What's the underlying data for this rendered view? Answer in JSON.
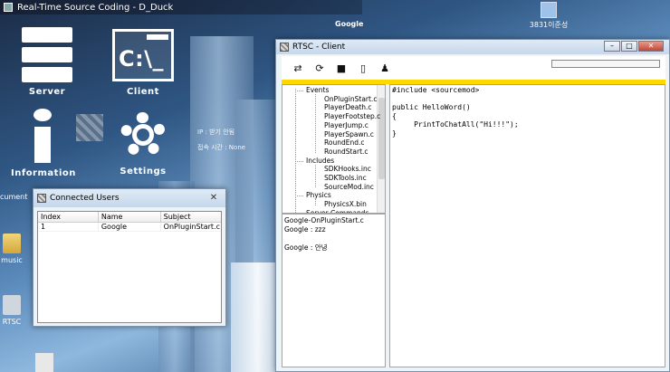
{
  "app": {
    "title": "Real-Time Source Coding - D_Duck"
  },
  "desktop": {
    "tiles": {
      "server": "Server",
      "client": "Client",
      "client_glyph": "C:\\_",
      "information": "Information",
      "settings": "Settings"
    },
    "info_lines": [
      "IP : 받기 안됨",
      "접속 시간 : None"
    ],
    "corner_text": "Google",
    "left_icons": [
      "cument",
      "music",
      "RTSC"
    ],
    "right_icon_label": "3831이준성"
  },
  "users_window": {
    "title": "Connected Users",
    "close": "✕",
    "columns": [
      "Index",
      "Name",
      "Subject"
    ],
    "rows": [
      {
        "index": "1",
        "name": "Google",
        "subject": "OnPluginStart.c"
      }
    ]
  },
  "client_window": {
    "title": "RTSC - Client",
    "controls": {
      "minimize": "–",
      "maximize": "□",
      "close": "✕"
    },
    "toolbar": [
      {
        "name": "connect-icon",
        "glyph": "⇄"
      },
      {
        "name": "refresh-icon",
        "glyph": "⟳"
      },
      {
        "name": "save-icon",
        "glyph": "■"
      },
      {
        "name": "clipboard-icon",
        "glyph": "▯"
      },
      {
        "name": "user-icon",
        "glyph": "♟"
      }
    ],
    "tree": {
      "groups": [
        {
          "label": "Events",
          "items": [
            "OnPluginStart.c",
            "PlayerDeath.c",
            "PlayerFootstep.c",
            "PlayerJump.c",
            "PlayerSpawn.c",
            "RoundEnd.c",
            "RoundStart.c"
          ]
        },
        {
          "label": "Includes",
          "items": [
            "SDKHooks.inc",
            "SDKTools.inc",
            "SourceMod.inc"
          ]
        },
        {
          "label": "Physics",
          "items": [
            "PhysicsX.bin"
          ]
        },
        {
          "label": "Server Commands",
          "items": []
        }
      ]
    },
    "log": [
      "Google-OnPluginStart.c",
      "Google : zzz",
      "",
      "Google : 안녕"
    ],
    "editor_lines": [
      "#include <sourcemod>",
      "",
      "public HelloWord()",
      "{",
      "     PrintToChatAll(\"Hi!!!\");",
      "}"
    ]
  },
  "colors": {
    "accent_bar": "#ffd800"
  }
}
